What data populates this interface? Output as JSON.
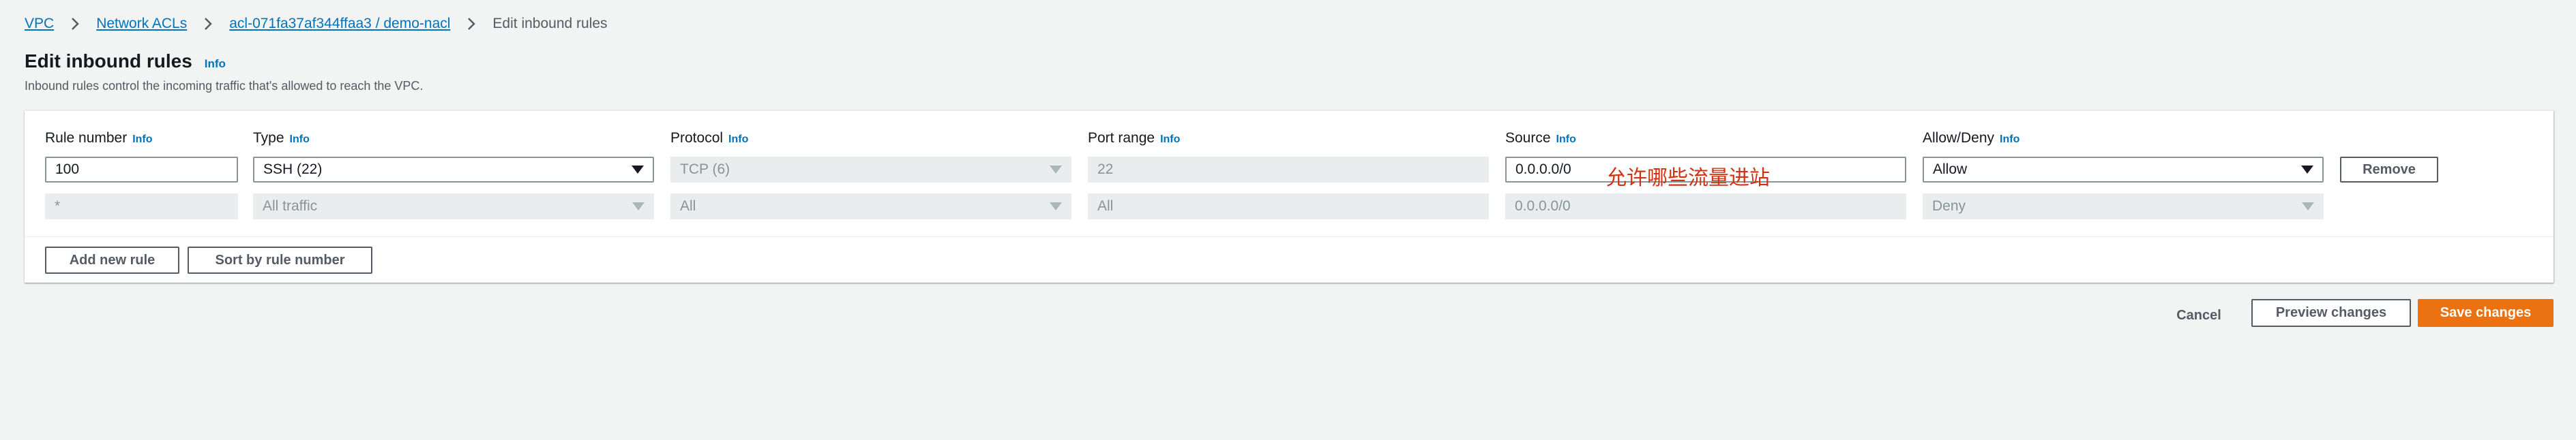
{
  "breadcrumb": {
    "items": [
      "VPC",
      "Network ACLs",
      "acl-071fa37af344ffaa3 / demo-nacl"
    ],
    "current": "Edit inbound rules"
  },
  "header": {
    "title": "Edit inbound rules",
    "info": "Info",
    "description": "Inbound rules control the incoming traffic that's allowed to reach the VPC."
  },
  "columns": [
    {
      "label": "Rule number",
      "info": "Info"
    },
    {
      "label": "Type",
      "info": "Info"
    },
    {
      "label": "Protocol",
      "info": "Info"
    },
    {
      "label": "Port range",
      "info": "Info"
    },
    {
      "label": "Source",
      "info": "Info"
    },
    {
      "label": "Allow/Deny",
      "info": "Info"
    }
  ],
  "rows": [
    {
      "rule_number": "100",
      "type": "SSH (22)",
      "protocol": "TCP (6)",
      "port_range": "22",
      "source": "0.0.0.0/0",
      "action": "Allow",
      "remove_label": "Remove"
    },
    {
      "rule_number": "*",
      "type": "All traffic",
      "protocol": "All",
      "port_range": "All",
      "source": "0.0.0.0/0",
      "action": "Deny"
    }
  ],
  "annotation": "允许哪些流量进站",
  "buttons": {
    "add_rule": "Add new rule",
    "sort_rules": "Sort by rule number",
    "cancel": "Cancel",
    "preview": "Preview changes",
    "save": "Save changes"
  },
  "colors": {
    "link": "#0073bb",
    "primary": "#ec7211",
    "annotation": "#d13212",
    "background": "#f2f3f3"
  }
}
